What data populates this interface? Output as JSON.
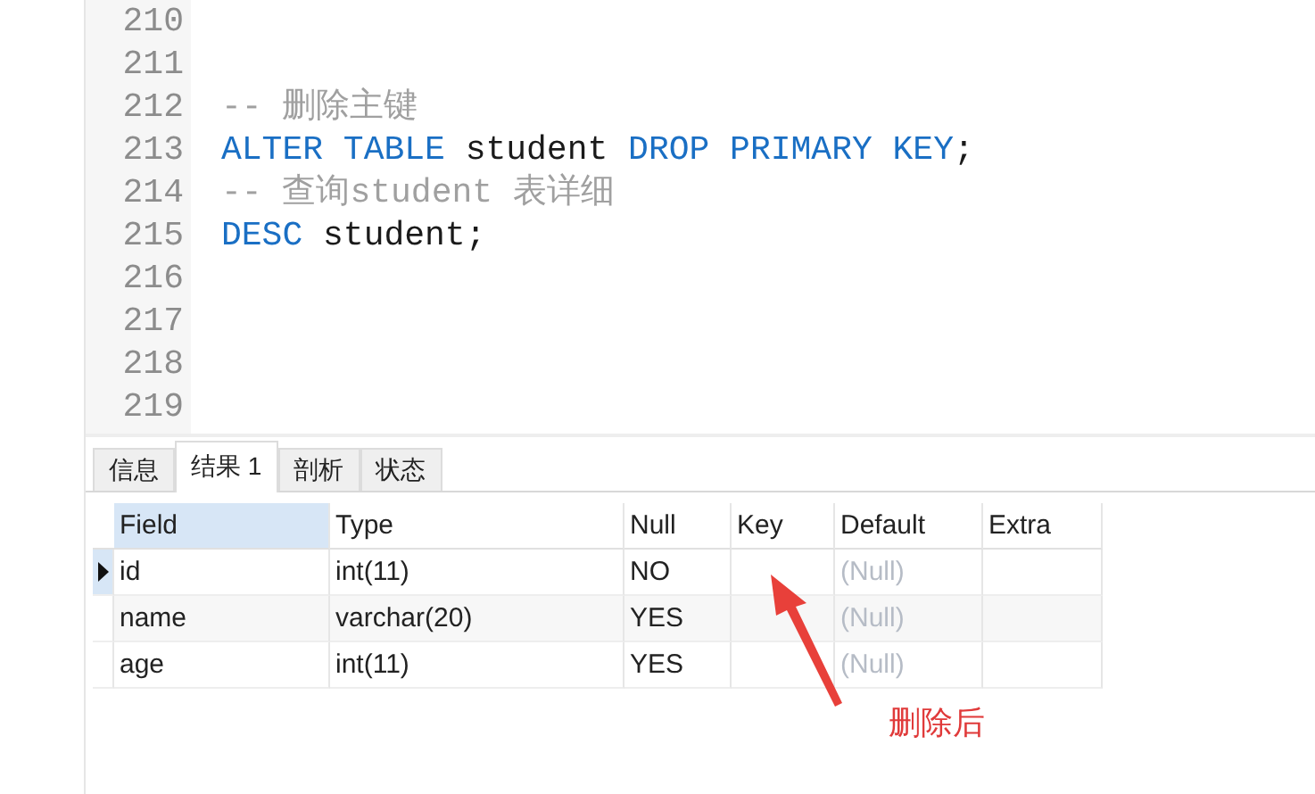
{
  "editor": {
    "lines": [
      {
        "number": "210"
      },
      {
        "number": "211"
      },
      {
        "number": "212",
        "tokens": [
          {
            "kind": "comment",
            "text": "-- 删除主键"
          }
        ]
      },
      {
        "number": "213",
        "tokens": [
          {
            "kind": "keyword",
            "text": "ALTER TABLE"
          },
          {
            "kind": "plain",
            "text": " student "
          },
          {
            "kind": "keyword",
            "text": "DROP PRIMARY KEY"
          },
          {
            "kind": "plain",
            "text": ";"
          }
        ]
      },
      {
        "number": "214",
        "tokens": [
          {
            "kind": "comment",
            "text": "-- 查询student 表详细"
          }
        ]
      },
      {
        "number": "215",
        "tokens": [
          {
            "kind": "keyword",
            "text": "DESC"
          },
          {
            "kind": "plain",
            "text": " student;"
          }
        ]
      },
      {
        "number": "216"
      },
      {
        "number": "217"
      },
      {
        "number": "218"
      },
      {
        "number": "219"
      }
    ]
  },
  "tabs": [
    {
      "label": "信息",
      "selected": false
    },
    {
      "label": "结果 1",
      "selected": true
    },
    {
      "label": "剖析",
      "selected": false
    },
    {
      "label": "状态",
      "selected": false
    }
  ],
  "table": {
    "columns": [
      {
        "label": "Field",
        "selected": true
      },
      {
        "label": "Type",
        "selected": false
      },
      {
        "label": "Null",
        "selected": false
      },
      {
        "label": "Key",
        "selected": false
      },
      {
        "label": "Default",
        "selected": false
      },
      {
        "label": "Extra",
        "selected": false
      }
    ],
    "rows": [
      {
        "current": true,
        "cells": [
          {
            "kind": "value",
            "text": "id"
          },
          {
            "kind": "value",
            "text": "int(11)"
          },
          {
            "kind": "value",
            "text": "NO"
          },
          {
            "kind": "empty"
          },
          {
            "kind": "null",
            "text": "(Null)"
          },
          {
            "kind": "empty"
          }
        ]
      },
      {
        "current": false,
        "cells": [
          {
            "kind": "value",
            "text": "name"
          },
          {
            "kind": "value",
            "text": "varchar(20)"
          },
          {
            "kind": "value",
            "text": "YES"
          },
          {
            "kind": "empty"
          },
          {
            "kind": "null",
            "text": "(Null)"
          },
          {
            "kind": "empty"
          }
        ]
      },
      {
        "current": false,
        "cells": [
          {
            "kind": "value",
            "text": "age"
          },
          {
            "kind": "value",
            "text": "int(11)"
          },
          {
            "kind": "value",
            "text": "YES"
          },
          {
            "kind": "empty"
          },
          {
            "kind": "null",
            "text": "(Null)"
          },
          {
            "kind": "empty"
          }
        ]
      }
    ]
  },
  "annotation": {
    "label": "删除后"
  }
}
